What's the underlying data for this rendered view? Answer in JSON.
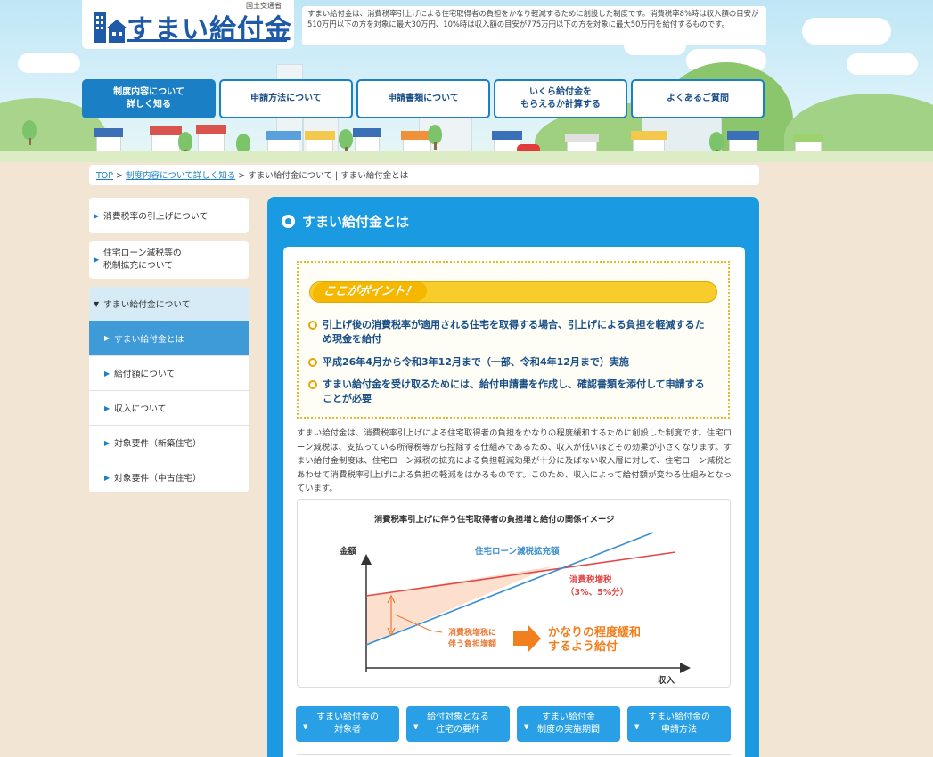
{
  "header": {
    "ministry": "国土交通省",
    "logo_text": "すまい給付金",
    "intro": "すまい給付金は、消費税率引上げによる住宅取得者の負担をかなり軽減するために創設した制度です。消費税率8%時は収入額の目安が510万円以下の方を対象に最大30万円、10%時は収入額の目安が775万円以下の方を対象に最大50万円を給付するものです。"
  },
  "nav": [
    {
      "line1": "制度内容について",
      "line2": "詳しく知る",
      "active": true
    },
    {
      "line1": "申請方法について",
      "line2": "",
      "active": false
    },
    {
      "line1": "申請書類について",
      "line2": "",
      "active": false
    },
    {
      "line1": "いくら給付金を",
      "line2": "もらえるか計算する",
      "active": false
    },
    {
      "line1": "よくあるご質問",
      "line2": "",
      "active": false
    }
  ],
  "breadcrumb": {
    "top": "TOP",
    "sep": ">",
    "level1": "制度内容について詳しく知る",
    "current": "すまい給付金について | すまい給付金とは"
  },
  "sidebar": {
    "item1": "消費税率の引上げについて",
    "item2_line1": "住宅ローン減税等の",
    "item2_line2": "税制拡充について",
    "group_head": "すまい給付金について",
    "subs": [
      "すまい給付金とは",
      "給付額について",
      "収入について",
      "対象要件（新築住宅）",
      "対象要件（中古住宅）"
    ]
  },
  "main": {
    "title": "すまい給付金とは",
    "point_label": "ここがポイント！",
    "points": [
      {
        "line1": "引上げ後の消費税率が適用される住宅を取得する場合、引上げによる負担を軽減するた",
        "line2": "め現金を給付"
      },
      {
        "line1": "平成26年4月から令和3年12月まで（一部、令和4年12月まで）実施",
        "line2": ""
      },
      {
        "line1": "すまい給付金を受け取るためには、給付申請書を作成し、確認書類を添付して申請する",
        "line2": "ことが必要"
      }
    ],
    "description": "すまい給付金は、消費税率引上げによる住宅取得者の負担をかなりの程度緩和するために創設した制度です。住宅ローン減税は、支払っている所得税等から控除する仕組みであるため、収入が低いほどその効果が小さくなります。すまい給付金制度は、住宅ローン減税の拡充による負担軽減効果が十分に及ばない収入層に対して、住宅ローン減税とあわせて消費税率引上げによる負担の軽減をはかるものです。このため、収入によって給付額が変わる仕組みとなっています。"
  },
  "chart_data": {
    "type": "line",
    "title": "消費税率引上げに伴う住宅取得者の負担増と給付の関係イメージ",
    "ylabel": "金額",
    "xlabel": "収入",
    "series": [
      {
        "name": "住宅ローン減税拡充額",
        "color": "#3a8fd0"
      },
      {
        "name": "消費税増税",
        "color": "#e24848"
      }
    ],
    "annotations": {
      "tax_rate": "（3%、5%分）",
      "burden_line1": "消費税増税に",
      "burden_line2": "伴う負担増額",
      "relief_line1": "かなりの程度緩和",
      "relief_line2": "するよう給付"
    }
  },
  "tabs": [
    {
      "line1": "すまい給付金の",
      "line2": "対象者"
    },
    {
      "line1": "給付対象となる",
      "line2": "住宅の要件"
    },
    {
      "line1": "すまい給付金",
      "line2": "制度の実施期間"
    },
    {
      "line1": "すまい給付金の",
      "line2": "申請方法"
    }
  ],
  "colors": {
    "accent": "#1a9ae0",
    "nav_border": "#1a7fc4",
    "point_yellow": "#f8cc2b",
    "text_blue": "#1a4f86"
  }
}
